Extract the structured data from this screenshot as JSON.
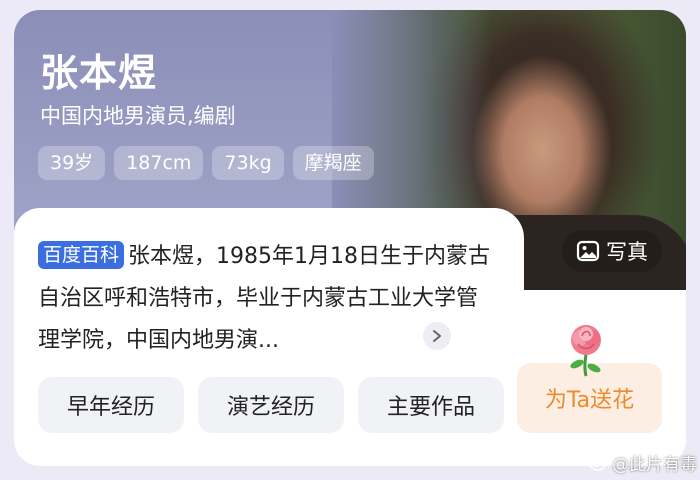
{
  "profile": {
    "name": "张本煜",
    "subtitle": "中国内地男演员,编剧",
    "tags": [
      "39岁",
      "187cm",
      "73kg",
      "摩羯座"
    ]
  },
  "photo_button": {
    "label": "写真",
    "icon": "image-icon"
  },
  "summary": {
    "badge": "百度百科",
    "text": "张本煜，1985年1月18日生于内蒙古自治区呼和浩特市，毕业于内蒙古工业大学管理学院，中国内地男演...",
    "more_icon": "chevron-right-icon"
  },
  "buttons": [
    "早年经历",
    "演艺经历",
    "主要作品"
  ],
  "flower_button": {
    "label": "为Ta送花",
    "icon": "rose-icon"
  },
  "watermark": {
    "text": "@此片有毒",
    "icon": "weibo-icon"
  },
  "colors": {
    "badge": "#3b6fe0",
    "flower_text": "#ef8a2a",
    "flower_bg": "#fdeee3"
  }
}
